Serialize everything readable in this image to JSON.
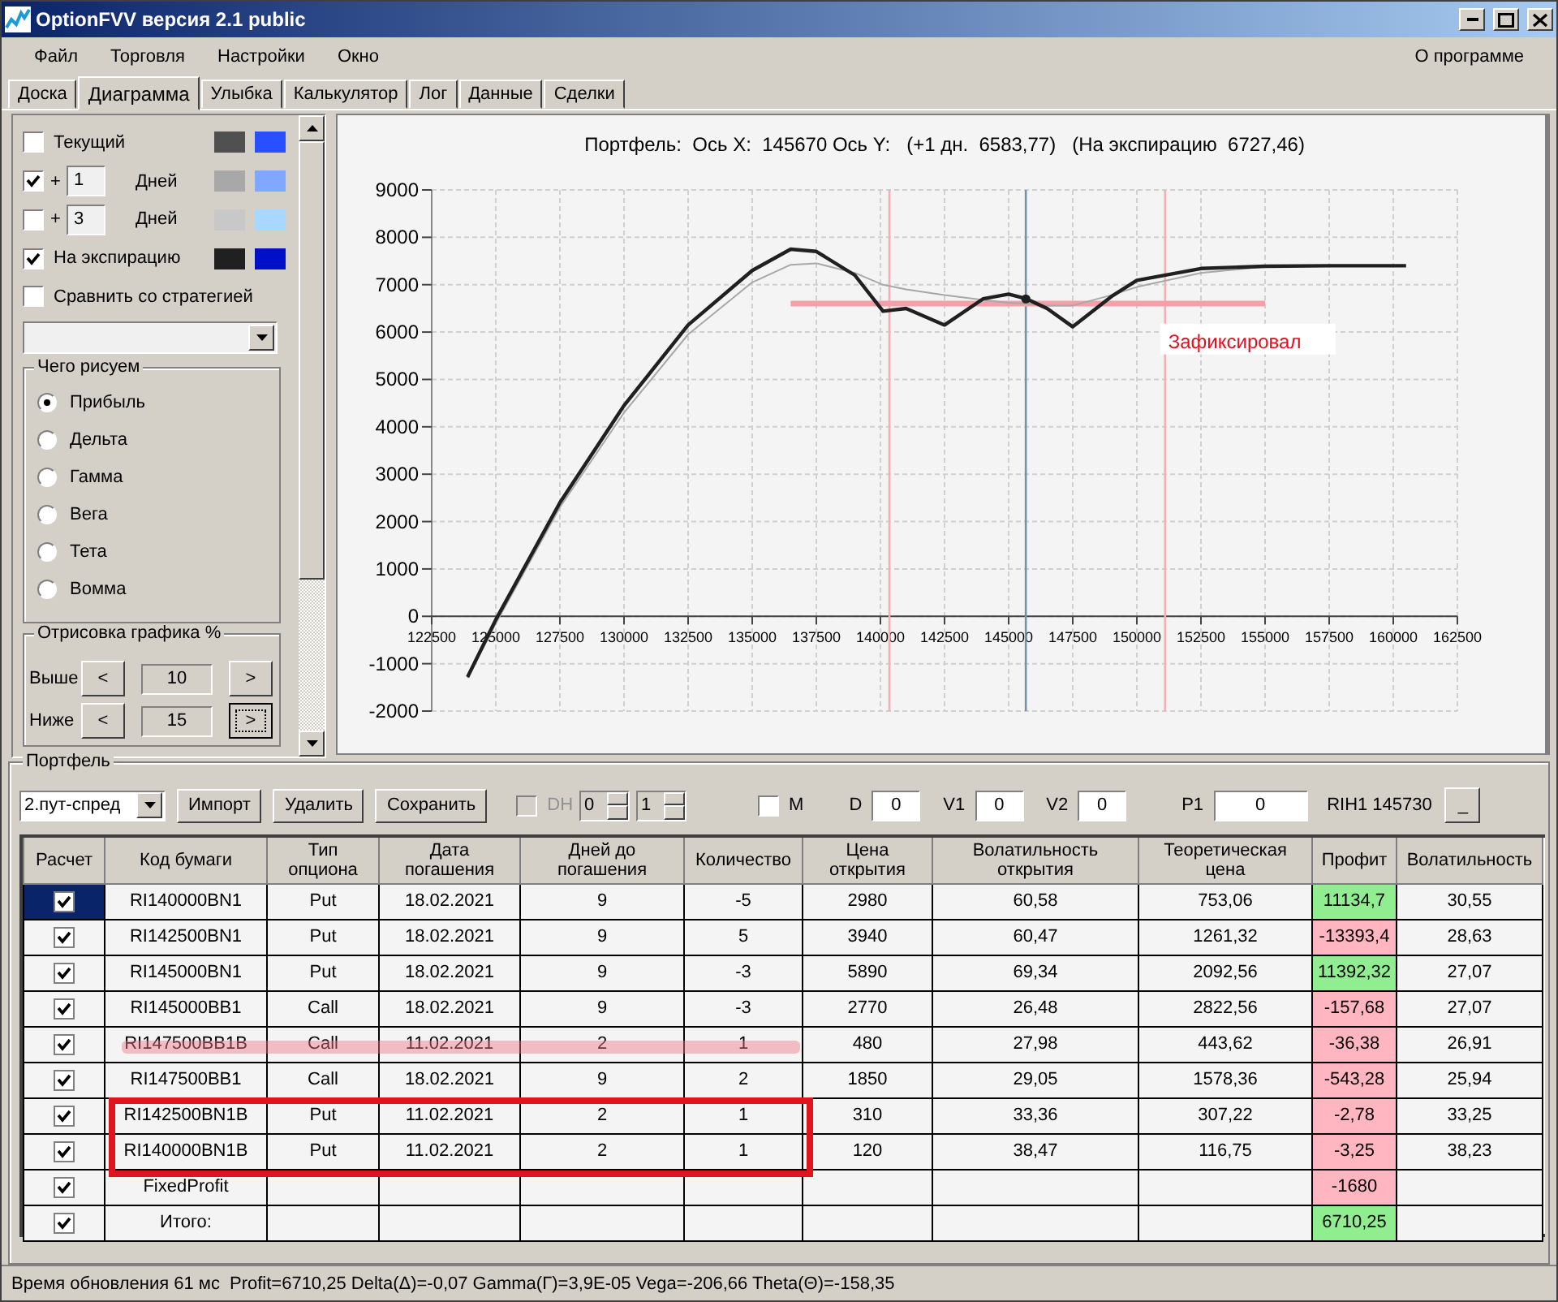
{
  "window": {
    "title": "OptionFVV версия 2.1 public"
  },
  "menu": [
    {
      "label": "Файл"
    },
    {
      "label": "Торговля"
    },
    {
      "label": "Настройки"
    },
    {
      "label": "Окно"
    }
  ],
  "menu_right": {
    "label": "О программе"
  },
  "tabs": [
    {
      "label": "Доска",
      "selected": false
    },
    {
      "label": "Диаграмма",
      "selected": true
    },
    {
      "label": "Улыбка",
      "selected": false
    },
    {
      "label": "Калькулятор",
      "selected": false
    },
    {
      "label": "Лог",
      "selected": false
    },
    {
      "label": "Данные",
      "selected": false
    },
    {
      "label": "Сделки",
      "selected": false
    }
  ],
  "curves": [
    {
      "kind": "curve",
      "label": "Текущий",
      "checked": false,
      "swatches": [
        {
          "color": "#505050"
        },
        {
          "color": "#2850ff"
        }
      ]
    },
    {
      "kind": "days",
      "prefix": "+",
      "days": "1",
      "unit": "Дней",
      "checked": true,
      "swatches": [
        {
          "color": "#a8a8a8"
        },
        {
          "color": "#80a8ff"
        }
      ]
    },
    {
      "kind": "days",
      "prefix": "+",
      "days": "3",
      "unit": "Дней",
      "checked": false,
      "swatches": [
        {
          "color": "#c8c8c8"
        },
        {
          "color": "#a8d8ff"
        }
      ]
    },
    {
      "kind": "curve",
      "label": "На экспирацию",
      "checked": true,
      "swatches": [
        {
          "color": "#202020"
        },
        {
          "color": "#0010c8"
        }
      ]
    },
    {
      "kind": "curve",
      "label": "Сравнить со стратегией",
      "checked": false
    }
  ],
  "draw_group": {
    "title": "Чего рисуем",
    "options": [
      {
        "label": "Прибыль",
        "selected": true
      },
      {
        "label": "Дельта",
        "selected": false
      },
      {
        "label": "Гамма",
        "selected": false
      },
      {
        "label": "Вега",
        "selected": false
      },
      {
        "label": "Тета",
        "selected": false
      },
      {
        "label": "Вомма",
        "selected": false
      }
    ]
  },
  "range_group": {
    "title": "Отрисовка графика %",
    "rows": [
      {
        "label": "Выше",
        "dec": "<",
        "value": "10",
        "inc": ">"
      },
      {
        "label": "Ниже",
        "dec": "<",
        "value": "15",
        "inc": ">"
      }
    ]
  },
  "chart_data": {
    "type": "line",
    "title": "Портфель:  Ось X:  145670 Ось Y:   (+1 дн.  6583,77)   (На экспирацию  6727,46)",
    "x": [
      123900,
      125000,
      127500,
      130000,
      132500,
      135000,
      136500,
      137500,
      139000,
      140100,
      141000,
      142500,
      144000,
      145000,
      145700,
      146500,
      147500,
      149000,
      150000,
      152500,
      155000,
      157500,
      160500
    ],
    "series": [
      {
        "color": "#202020",
        "values": [
          -1280,
          -70,
          2400,
          4450,
          6150,
          7300,
          7750,
          7700,
          7200,
          6440,
          6500,
          6150,
          6700,
          6800,
          6700,
          6500,
          6110,
          6750,
          7090,
          7340,
          7390,
          7400,
          7400
        ]
      },
      {
        "color": "#a8a8a8",
        "values": [
          -1300,
          -150,
          2300,
          4300,
          5950,
          7050,
          7420,
          7450,
          7250,
          7000,
          6900,
          6780,
          6680,
          6620,
          6600,
          6560,
          6560,
          6780,
          6950,
          7250,
          7380,
          7400,
          null
        ]
      },
      {
        "color": "#f4a0a8",
        "values": [
          null,
          null,
          null,
          null,
          null,
          null,
          6600,
          6600,
          6600,
          6600,
          6600,
          6600,
          6600,
          6600,
          6600,
          6600,
          6600,
          6600,
          6600,
          6600,
          6600,
          null,
          null
        ]
      }
    ],
    "ref_lines": [
      {
        "axis": "x",
        "value": 140350,
        "color": "#f4b0b4"
      },
      {
        "axis": "x",
        "value": 151100,
        "color": "#f4b0b4"
      },
      {
        "axis": "x",
        "value": 145670,
        "color": "#7890b0"
      }
    ],
    "xlim": [
      122500,
      162500
    ],
    "ylim": [
      -2000,
      9000
    ],
    "xticks": [
      122500,
      125000,
      127500,
      130000,
      132500,
      135000,
      137500,
      140000,
      142500,
      145000,
      147500,
      150000,
      152500,
      155000,
      157500,
      160000,
      162500
    ],
    "yticks": [
      -2000,
      -1000,
      0,
      1000,
      2000,
      3000,
      4000,
      5000,
      6000,
      7000,
      8000,
      9000
    ],
    "grid": true,
    "annotations": [
      "Зафиксировал"
    ]
  },
  "portfolio": {
    "title": "Портфель",
    "strategy": "2.пут-спред",
    "buttons": [
      {
        "label": "Импорт"
      },
      {
        "label": "Удалить"
      },
      {
        "label": "Сохранить"
      }
    ],
    "dh": {
      "label": "DH",
      "checked": false,
      "disabled": true
    },
    "spinners": [
      {
        "value": "0"
      },
      {
        "value": "1"
      }
    ],
    "m": {
      "label": "M",
      "checked": false
    },
    "fields": [
      {
        "label": "D",
        "value": "0"
      },
      {
        "label": "V1",
        "value": "0"
      },
      {
        "label": "V2",
        "value": "0"
      },
      {
        "label": "P1",
        "value": "0"
      }
    ],
    "quote": "RIH1 145730",
    "min_button": "_"
  },
  "table": {
    "check_column": "Расчет",
    "columns": [
      "Код бумаги",
      "Тип опциона",
      "Дата погашения",
      "Дней до погашения",
      "Количество",
      "Цена открытия",
      "Волатильность открытия",
      "Теоретическая цена",
      "Профит",
      "Волатильность"
    ],
    "rows": [
      {
        "checked": true,
        "selected": true,
        "struck": false,
        "outlined": false,
        "cells": [
          "RI140000BN1",
          "Put",
          "18.02.2021",
          "9",
          "-5",
          "2980",
          "60,58",
          "753,06",
          "11134,7",
          "30,55"
        ],
        "color": "#90ee90"
      },
      {
        "checked": true,
        "selected": false,
        "struck": false,
        "outlined": false,
        "cells": [
          "RI142500BN1",
          "Put",
          "18.02.2021",
          "9",
          "5",
          "3940",
          "60,47",
          "1261,32",
          "-13393,4",
          "28,63"
        ],
        "color": "#ffb6c1"
      },
      {
        "checked": true,
        "selected": false,
        "struck": false,
        "outlined": false,
        "cells": [
          "RI145000BN1",
          "Put",
          "18.02.2021",
          "9",
          "-3",
          "5890",
          "69,34",
          "2092,56",
          "11392,32",
          "27,07"
        ],
        "color": "#90ee90"
      },
      {
        "checked": true,
        "selected": false,
        "struck": false,
        "outlined": false,
        "cells": [
          "RI145000BB1",
          "Call",
          "18.02.2021",
          "9",
          "-3",
          "2770",
          "26,48",
          "2822,56",
          "-157,68",
          "27,07"
        ],
        "color": "#ffb6c1"
      },
      {
        "checked": true,
        "selected": false,
        "struck": true,
        "outlined": false,
        "cells": [
          "RI147500BB1B",
          "Call",
          "11.02.2021",
          "2",
          "1",
          "480",
          "27,98",
          "443,62",
          "-36,38",
          "26,91"
        ],
        "color": "#ffb6c1"
      },
      {
        "checked": true,
        "selected": false,
        "struck": false,
        "outlined": false,
        "cells": [
          "RI147500BB1",
          "Call",
          "18.02.2021",
          "9",
          "2",
          "1850",
          "29,05",
          "1578,36",
          "-543,28",
          "25,94"
        ],
        "color": "#ffb6c1"
      },
      {
        "checked": true,
        "selected": false,
        "struck": false,
        "outlined": true,
        "cells": [
          "RI142500BN1B",
          "Put",
          "11.02.2021",
          "2",
          "1",
          "310",
          "33,36",
          "307,22",
          "-2,78",
          "33,25"
        ],
        "color": "#ffb6c1"
      },
      {
        "checked": true,
        "selected": false,
        "struck": false,
        "outlined": true,
        "cells": [
          "RI140000BN1B",
          "Put",
          "11.02.2021",
          "2",
          "1",
          "120",
          "38,47",
          "116,75",
          "-3,25",
          "38,23"
        ],
        "color": "#ffb6c1"
      },
      {
        "checked": true,
        "selected": false,
        "struck": false,
        "outlined": false,
        "cells": [
          "FixedProfit",
          "",
          "",
          "",
          "",
          "",
          "",
          "",
          "-1680",
          ""
        ],
        "color": "#ffb6c1"
      },
      {
        "checked": true,
        "selected": false,
        "struck": false,
        "outlined": false,
        "cells": [
          "Итого:",
          "",
          "",
          "",
          "",
          "",
          "",
          "",
          "6710,25",
          ""
        ],
        "color": "#90ee90"
      }
    ]
  },
  "status_bar": {
    "update": "Время обновления 61 мс",
    "stats": "Profit=6710,25 Delta(Δ)=-0,07 Gamma(Γ)=3,9E-05 Vega=-206,66 Theta(Θ)=-158,35"
  }
}
